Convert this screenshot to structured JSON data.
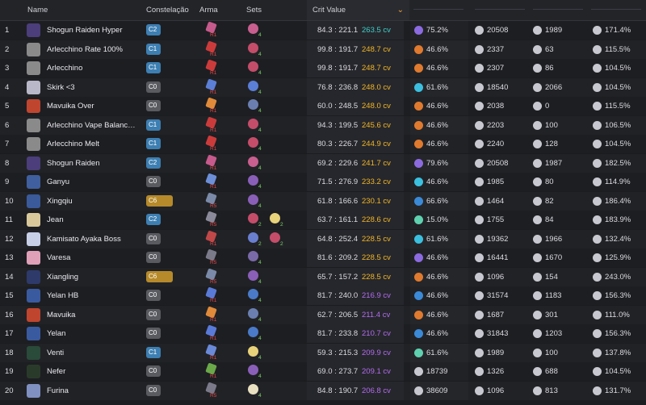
{
  "headers": {
    "name": "Name",
    "constelacao": "Constelação",
    "arma": "Arma",
    "sets": "Sets",
    "crit_value": "Crit Value",
    "sort_icon": "chevron-down-icon"
  },
  "colors": {
    "cv_teal": "#3fd0c9",
    "cv_gold": "#f2b627",
    "cv_purple": "#b46cf0",
    "c_blue": "#3d7fb2",
    "c_gray": "#5a5b61",
    "c_gold": "#b68a2a"
  },
  "rows": [
    {
      "rank": "1",
      "name": "Shogun Raiden Hyper",
      "cons": "C2",
      "ref": "R1",
      "set_n": "4",
      "crit": "84.3 : 221.1",
      "cv": "263.5 cv",
      "cv_color": "teal",
      "elem_pct": "75.2%",
      "hp": "20508",
      "atk": "1989",
      "er": "171.4%",
      "avatar": "#4b3e7a",
      "weapon": "#c65a8c",
      "set": "#c85f8f",
      "elem": "#8c6be0",
      "cons_color": "blue",
      "set2": "",
      "set2n": ""
    },
    {
      "rank": "2",
      "name": "Arlecchino Rate 100%",
      "cons": "C1",
      "ref": "R1",
      "set_n": "4",
      "crit": "99.8 : 191.7",
      "cv": "248.7 cv",
      "cv_color": "gold",
      "elem_pct": "46.6%",
      "hp": "2337",
      "atk": "63",
      "er": "115.5%",
      "avatar": "#8a8a8a",
      "weapon": "#cc3b3b",
      "set": "#c44d6a",
      "elem": "#e07a2e",
      "cons_color": "blue",
      "set2": "",
      "set2n": ""
    },
    {
      "rank": "3",
      "name": "Arlecchino",
      "cons": "C1",
      "ref": "R1",
      "set_n": "4",
      "crit": "99.8 : 191.7",
      "cv": "248.7 cv",
      "cv_color": "gold",
      "elem_pct": "46.6%",
      "hp": "2307",
      "atk": "86",
      "er": "104.5%",
      "avatar": "#8a8a8a",
      "weapon": "#cc3b3b",
      "set": "#c44d6a",
      "elem": "#e07a2e",
      "cons_color": "blue",
      "set2": "",
      "set2n": ""
    },
    {
      "rank": "4",
      "name": "Skirk <3",
      "cons": "C0",
      "ref": "R1",
      "set_n": "4",
      "crit": "76.8 : 236.8",
      "cv": "248.0 cv",
      "cv_color": "gold",
      "elem_pct": "61.6%",
      "hp": "18540",
      "atk": "2066",
      "er": "104.5%",
      "avatar": "#b8b8c8",
      "weapon": "#5b7fd6",
      "set": "#5b7fd6",
      "elem": "#3bc0e0",
      "cons_color": "gray",
      "set2": "",
      "set2n": ""
    },
    {
      "rank": "5",
      "name": "Mavuika Over",
      "cons": "C0",
      "ref": "R1",
      "set_n": "4",
      "crit": "60.0 : 248.5",
      "cv": "248.0 cv",
      "cv_color": "gold",
      "elem_pct": "46.6%",
      "hp": "2038",
      "atk": "0",
      "er": "115.5%",
      "avatar": "#c0452f",
      "weapon": "#e08a3a",
      "set": "#6a7fb0",
      "elem": "#e07a2e",
      "cons_color": "gray",
      "set2": "",
      "set2n": ""
    },
    {
      "rank": "6",
      "name": "Arlecchino Vape Balanc…",
      "cons": "C1",
      "ref": "R1",
      "set_n": "4",
      "crit": "94.3 : 199.5",
      "cv": "245.6 cv",
      "cv_color": "gold",
      "elem_pct": "46.6%",
      "hp": "2203",
      "atk": "100",
      "er": "106.5%",
      "avatar": "#8a8a8a",
      "weapon": "#cc3b3b",
      "set": "#c44d6a",
      "elem": "#e07a2e",
      "cons_color": "blue",
      "set2": "",
      "set2n": ""
    },
    {
      "rank": "7",
      "name": "Arlecchino Melt",
      "cons": "C1",
      "ref": "R1",
      "set_n": "4",
      "crit": "80.3 : 226.7",
      "cv": "244.9 cv",
      "cv_color": "gold",
      "elem_pct": "46.6%",
      "hp": "2240",
      "atk": "128",
      "er": "104.5%",
      "avatar": "#8a8a8a",
      "weapon": "#cc3b3b",
      "set": "#c44d6a",
      "elem": "#e07a2e",
      "cons_color": "blue",
      "set2": "",
      "set2n": ""
    },
    {
      "rank": "8",
      "name": "Shogun Raiden",
      "cons": "C2",
      "ref": "R1",
      "set_n": "4",
      "crit": "69.2 : 229.6",
      "cv": "241.7 cv",
      "cv_color": "gold",
      "elem_pct": "79.6%",
      "hp": "20508",
      "atk": "1987",
      "er": "182.5%",
      "avatar": "#4b3e7a",
      "weapon": "#c65a8c",
      "set": "#c85f8f",
      "elem": "#8c6be0",
      "cons_color": "blue",
      "set2": "",
      "set2n": ""
    },
    {
      "rank": "9",
      "name": "Ganyu",
      "cons": "C0",
      "ref": "R1",
      "set_n": "4",
      "crit": "71.5 : 276.9",
      "cv": "233.2 cv",
      "cv_color": "gold",
      "elem_pct": "46.6%",
      "hp": "1985",
      "atk": "80",
      "er": "114.9%",
      "avatar": "#3f5f9f",
      "weapon": "#6c8fd8",
      "set": "#8a5fb8",
      "elem": "#3bc0e0",
      "cons_color": "gray",
      "set2": "",
      "set2n": ""
    },
    {
      "rank": "10",
      "name": "Xingqiu",
      "cons": "C6",
      "ref": "R5",
      "set_n": "4",
      "crit": "61.8 : 166.6",
      "cv": "230.1 cv",
      "cv_color": "gold",
      "elem_pct": "66.6%",
      "hp": "1464",
      "atk": "82",
      "er": "186.4%",
      "avatar": "#3a5a9a",
      "weapon": "#7a8aa8",
      "set": "#8a5fb8",
      "elem": "#3a8ad8",
      "cons_color": "gold",
      "set2": "",
      "set2n": ""
    },
    {
      "rank": "11",
      "name": "Jean",
      "cons": "C2",
      "ref": "R5",
      "set_n": "2",
      "crit": "63.7 : 161.1",
      "cv": "228.6 cv",
      "cv_color": "gold",
      "elem_pct": "15.0%",
      "hp": "1755",
      "atk": "84",
      "er": "183.9%",
      "avatar": "#d8c89a",
      "weapon": "#8a8a9a",
      "set": "#c44d6a",
      "elem": "#5fd0b0",
      "cons_color": "blue",
      "set2": "#e8d27a",
      "set2n": "2"
    },
    {
      "rank": "12",
      "name": "Kamisato Ayaka Boss",
      "cons": "C0",
      "ref": "R1",
      "set_n": "2",
      "crit": "64.8 : 252.4",
      "cv": "228.5 cv",
      "cv_color": "gold",
      "elem_pct": "61.6%",
      "hp": "19362",
      "atk": "1966",
      "er": "132.4%",
      "avatar": "#c8d0e8",
      "weapon": "#c04848",
      "set": "#6a7fd0",
      "elem": "#3bc0e0",
      "cons_color": "gray",
      "set2": "#c44d6a",
      "set2n": "2"
    },
    {
      "rank": "13",
      "name": "Varesa",
      "cons": "C0",
      "ref": "R5",
      "set_n": "4",
      "crit": "81.6 : 209.2",
      "cv": "228.5 cv",
      "cv_color": "gold",
      "elem_pct": "46.6%",
      "hp": "16441",
      "atk": "1670",
      "er": "125.9%",
      "avatar": "#e0a0b8",
      "weapon": "#7a7a8a",
      "set": "#7a6aa8",
      "elem": "#8c6be0",
      "cons_color": "gray",
      "set2": "",
      "set2n": ""
    },
    {
      "rank": "14",
      "name": "Xiangling",
      "cons": "C6",
      "ref": "R5",
      "set_n": "4",
      "crit": "65.7 : 157.2",
      "cv": "228.5 cv",
      "cv_color": "gold",
      "elem_pct": "46.6%",
      "hp": "1096",
      "atk": "154",
      "er": "243.0%",
      "avatar": "#2e3a6a",
      "weapon": "#7a8aa8",
      "set": "#8a5fb8",
      "elem": "#e07a2e",
      "cons_color": "gold",
      "set2": "",
      "set2n": ""
    },
    {
      "rank": "15",
      "name": "Yelan HB",
      "cons": "C0",
      "ref": "R1",
      "set_n": "4",
      "crit": "81.7 : 240.0",
      "cv": "216.9 cv",
      "cv_color": "purple",
      "elem_pct": "46.6%",
      "hp": "31574",
      "atk": "1183",
      "er": "156.3%",
      "avatar": "#3a5aa0",
      "weapon": "#5a7ad8",
      "set": "#4a7ac8",
      "elem": "#3a8ad8",
      "cons_color": "gray",
      "set2": "",
      "set2n": ""
    },
    {
      "rank": "16",
      "name": "Mavuika",
      "cons": "C0",
      "ref": "R1",
      "set_n": "4",
      "crit": "62.7 : 206.5",
      "cv": "211.4 cv",
      "cv_color": "purple",
      "elem_pct": "46.6%",
      "hp": "1687",
      "atk": "301",
      "er": "111.0%",
      "avatar": "#c0452f",
      "weapon": "#e08a3a",
      "set": "#6a7fb0",
      "elem": "#e07a2e",
      "cons_color": "gray",
      "set2": "",
      "set2n": ""
    },
    {
      "rank": "17",
      "name": "Yelan",
      "cons": "C0",
      "ref": "R1",
      "set_n": "4",
      "crit": "81.7 : 233.8",
      "cv": "210.7 cv",
      "cv_color": "purple",
      "elem_pct": "46.6%",
      "hp": "31843",
      "atk": "1203",
      "er": "156.3%",
      "avatar": "#3a5aa0",
      "weapon": "#5a7ad8",
      "set": "#4a7ac8",
      "elem": "#3a8ad8",
      "cons_color": "gray",
      "set2": "",
      "set2n": ""
    },
    {
      "rank": "18",
      "name": "Venti",
      "cons": "C1",
      "ref": "R1",
      "set_n": "4",
      "crit": "59.3 : 215.3",
      "cv": "209.9 cv",
      "cv_color": "purple",
      "elem_pct": "61.6%",
      "hp": "1989",
      "atk": "100",
      "er": "137.8%",
      "avatar": "#2a4a3a",
      "weapon": "#6a8ad8",
      "set": "#e8d27a",
      "elem": "#5fd0b0",
      "cons_color": "blue",
      "set2": "",
      "set2n": ""
    },
    {
      "rank": "19",
      "name": "Nefer",
      "cons": "C0",
      "ref": "R1",
      "set_n": "4",
      "crit": "69.0 : 273.7",
      "cv": "209.1 cv",
      "cv_color": "purple",
      "elem_pct": "",
      "hp": "18739",
      "atk": "1326",
      "er": "",
      "atk2": "688",
      "er2": "104.5%",
      "avatar": "#2a3a2a",
      "weapon": "#6aa84a",
      "set": "#8a5fb8",
      "elem": "#dcdce2",
      "cons_color": "gray",
      "set2": "",
      "set2n": "",
      "alt": true
    },
    {
      "rank": "20",
      "name": "Furina",
      "cons": "C0",
      "ref": "R5",
      "set_n": "4",
      "crit": "84.8 : 190.7",
      "cv": "206.8 cv",
      "cv_color": "purple",
      "elem_pct": "",
      "hp": "38609",
      "atk": "1096",
      "er": "",
      "atk2": "813",
      "er2": "131.7%",
      "avatar": "#8090c0",
      "weapon": "#7a7a8a",
      "set": "#e8e0c0",
      "elem": "#dcdce2",
      "cons_color": "gray",
      "set2": "",
      "set2n": "",
      "alt": true
    }
  ]
}
